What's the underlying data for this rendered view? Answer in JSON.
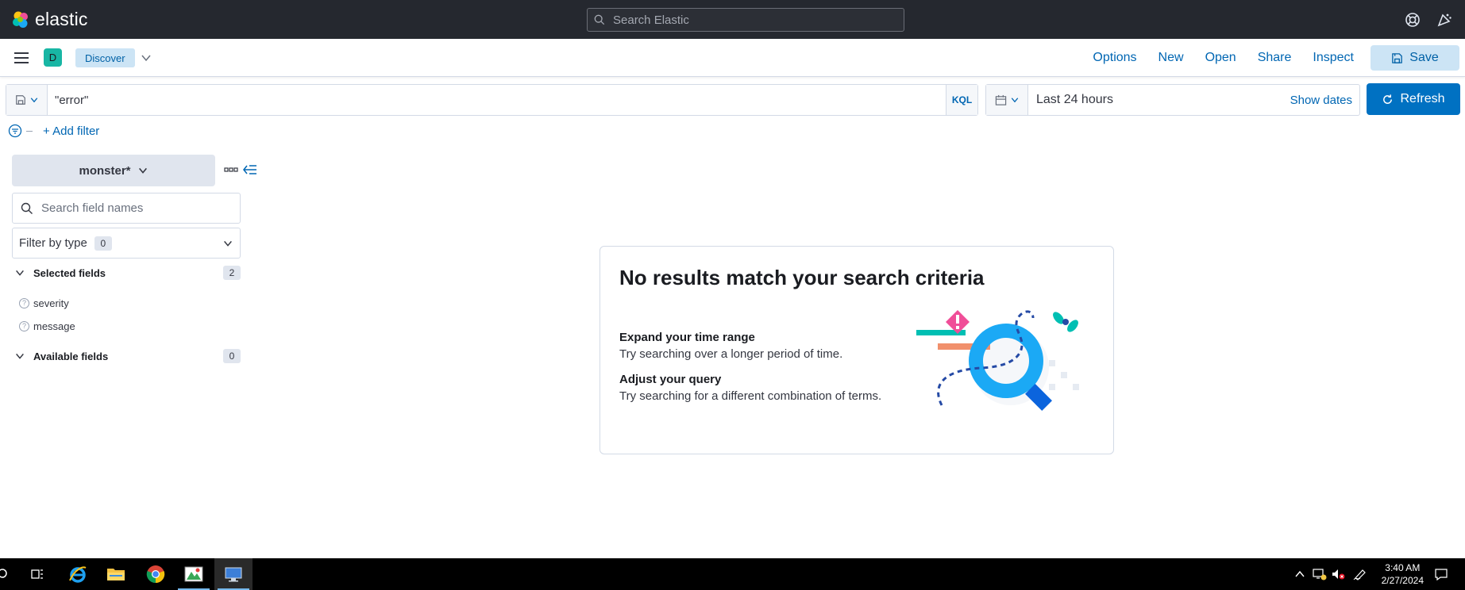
{
  "header": {
    "logo_text": "elastic",
    "search_placeholder": "Search Elastic"
  },
  "app_bar": {
    "space_initial": "D",
    "breadcrumb": "Discover",
    "menu": {
      "options": "Options",
      "new": "New",
      "open": "Open",
      "share": "Share",
      "inspect": "Inspect",
      "save": "Save"
    }
  },
  "query": {
    "value": "\"error\"",
    "language": "KQL"
  },
  "time": {
    "range": "Last 24 hours",
    "show_dates": "Show dates",
    "refresh": "Refresh"
  },
  "filters": {
    "add_filter": "+ Add filter"
  },
  "sidebar": {
    "index_pattern": "monster*",
    "search_placeholder": "Search field names",
    "filter_by_type": "Filter by type",
    "filter_count": "0",
    "selected_fields_title": "Selected fields",
    "selected_fields_count": "2",
    "selected_fields": [
      "severity",
      "message"
    ],
    "available_fields_title": "Available fields",
    "available_fields_count": "0"
  },
  "no_results": {
    "title": "No results match your search criteria",
    "tip1_title": "Expand your time range",
    "tip1_text": "Try searching over a longer period of time.",
    "tip2_title": "Adjust your query",
    "tip2_text": "Try searching for a different combination of terms."
  },
  "taskbar": {
    "time": "3:40 AM",
    "date": "2/27/2024"
  },
  "colors": {
    "header_bg": "#25282f",
    "primary": "#0071c2",
    "link": "#0066b3",
    "space_badge": "#18b6a4"
  }
}
